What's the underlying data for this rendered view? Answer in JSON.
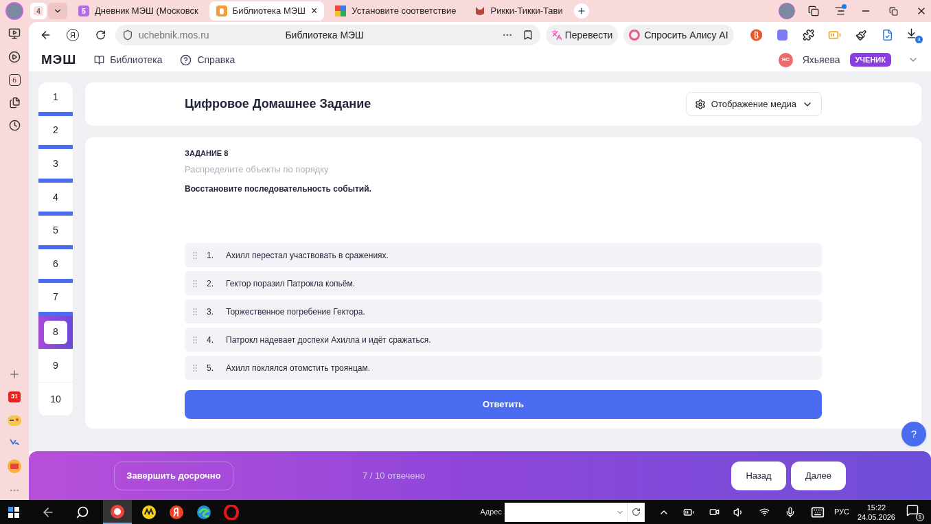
{
  "browser_tabs": {
    "group_count": "4",
    "tabs": [
      {
        "badge": "5",
        "title": "Дневник МЭШ (Московск",
        "selected": false
      },
      {
        "title": "Библиотека МЭШ",
        "selected": true,
        "close": "×"
      },
      {
        "title": "Установите соответствие",
        "selected": false
      },
      {
        "title": "Рикки-Тикки-Тави",
        "selected": false
      }
    ]
  },
  "browser_sidebar": {
    "tabs_badge": "6",
    "calendar_badge": "31"
  },
  "address_bar": {
    "home_letter": "Я",
    "url": "uchebnik.mos.ru",
    "page_title": "Библиотека МЭШ",
    "translate": "Перевести",
    "alice": "Спросить Алису AI",
    "downloads_badge": "3"
  },
  "site_header": {
    "logo": "МЭШ",
    "nav": [
      {
        "label": "Библиотека"
      },
      {
        "label": "Справка"
      }
    ],
    "user_initials": "ЯС",
    "user_name": "Яхьяева",
    "role": "УЧЕНИК"
  },
  "question_nav": [
    {
      "label": "1",
      "answered": true,
      "selected": false
    },
    {
      "label": "2",
      "answered": true,
      "selected": false
    },
    {
      "label": "3",
      "answered": true,
      "selected": false
    },
    {
      "label": "4",
      "answered": true,
      "selected": false
    },
    {
      "label": "5",
      "answered": true,
      "selected": false
    },
    {
      "label": "6",
      "answered": true,
      "selected": false
    },
    {
      "label": "7",
      "answered": true,
      "selected": false
    },
    {
      "label": "8",
      "answered": false,
      "selected": true
    },
    {
      "label": "9",
      "answered": false,
      "selected": false
    },
    {
      "label": "10",
      "answered": false,
      "selected": false
    }
  ],
  "header": {
    "title": "Цифровое Домашнее Задание",
    "media_dropdown": "Отображение медиа"
  },
  "task": {
    "number": "ЗАДАНИЕ 8",
    "type": "Распределите объекты по порядку",
    "instruction": "Восстановите последовательность событий.",
    "items": [
      {
        "number": "1.",
        "text": "Ахилл перестал участвовать в сражениях."
      },
      {
        "number": "2.",
        "text": "Гектор поразил Патрокла копьём."
      },
      {
        "number": "3.",
        "text": "Торжественное погребение Гектора."
      },
      {
        "number": "4.",
        "text": "Патрокл надевает доспехи Ахилла и идёт сражаться."
      },
      {
        "number": "5.",
        "text": "Ахилл поклялся отомстить троянцам."
      }
    ],
    "submit": "Ответить"
  },
  "help_button": "?",
  "bottom_bar": {
    "finish": "Завершить досрочно",
    "progress": "7 / 10 отвечено",
    "back": "Назад",
    "next": "Далее"
  },
  "taskbar": {
    "address_label": "Адрес",
    "language": "РУС",
    "time": "15:22",
    "date": "24.05.2026",
    "notifications_badge": "1"
  }
}
